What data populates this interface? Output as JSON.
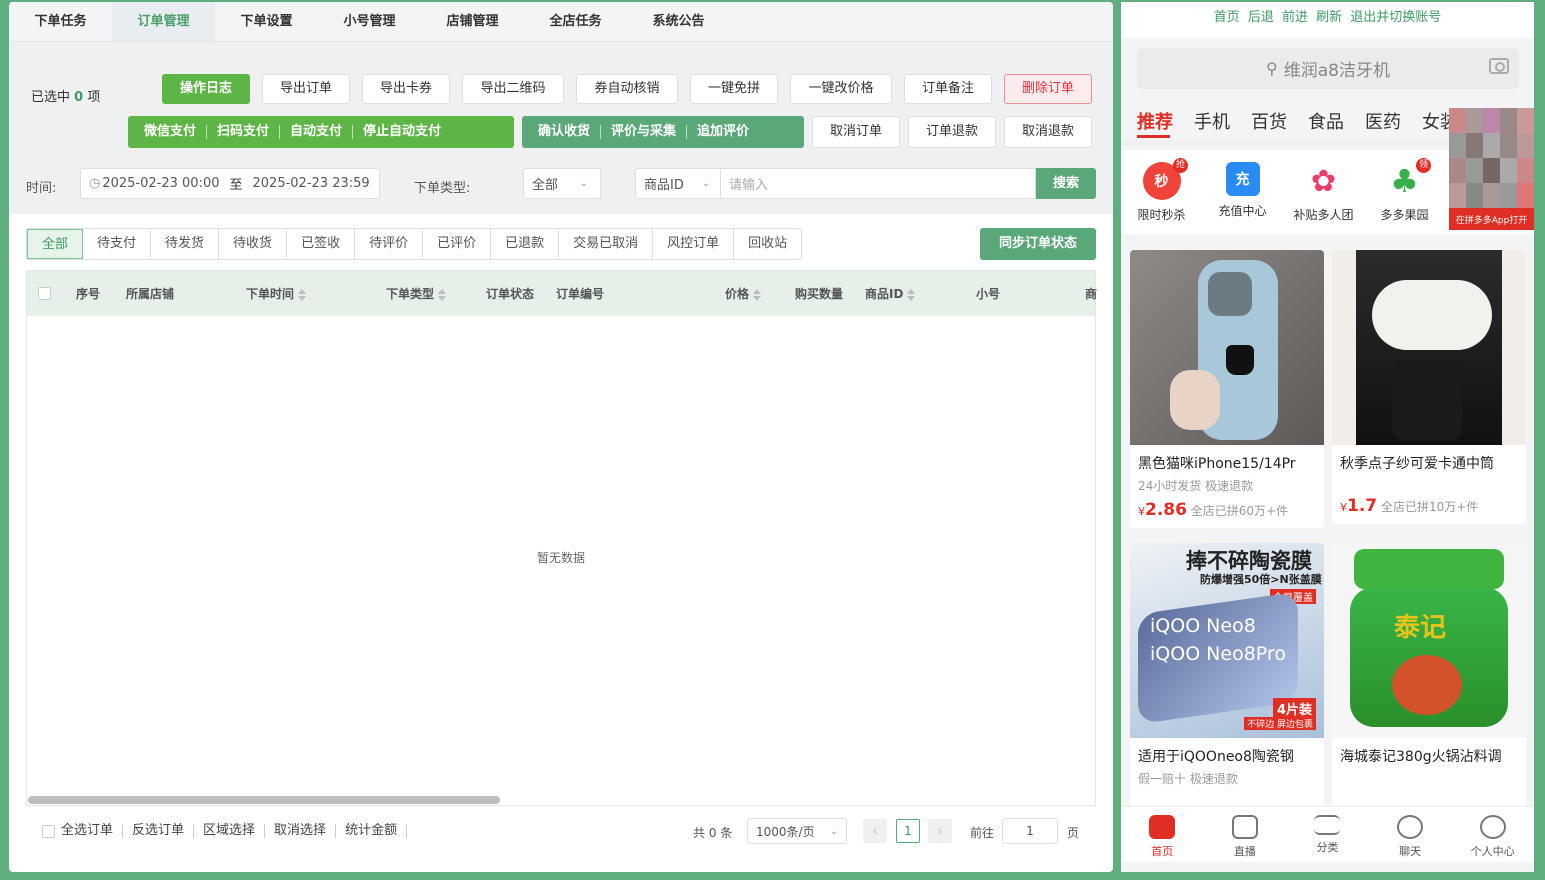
{
  "nav": {
    "tabs": [
      "下单任务",
      "订单管理",
      "下单设置",
      "小号管理",
      "店铺管理",
      "全店任务",
      "系统公告"
    ],
    "active_index": 1
  },
  "toolbar": {
    "selected_prefix": "已选中",
    "selected_count": "0",
    "selected_suffix": "项",
    "row1": [
      "操作日志",
      "导出订单",
      "导出卡券",
      "导出二维码",
      "券自动核销",
      "一键免拼",
      "一键改价格",
      "订单备注",
      "删除订单"
    ],
    "pay_group": [
      "微信支付",
      "扫码支付",
      "自动支付",
      "停止自动支付"
    ],
    "confirm_group": [
      "确认收货",
      "评价与采集",
      "追加评价"
    ],
    "row2_extra": [
      "取消订单",
      "订单退款",
      "取消退款"
    ]
  },
  "filters": {
    "time_label": "时间:",
    "time_start": "2025-02-23 00:00",
    "time_sep": "至",
    "time_end": "2025-02-23 23:59",
    "type_label": "下单类型:",
    "type_value": "全部",
    "field_select": "商品ID",
    "input_placeholder": "请输入",
    "search_label": "搜索"
  },
  "status_tabs": [
    "全部",
    "待支付",
    "待发货",
    "待收货",
    "已签收",
    "待评价",
    "已评价",
    "已退款",
    "交易已取消",
    "风控订单",
    "回收站"
  ],
  "sync_label": "同步订单状态",
  "table": {
    "columns": [
      "序号",
      "所属店铺",
      "下单时间",
      "下单类型",
      "订单状态",
      "订单编号",
      "价格",
      "购买数量",
      "商品ID",
      "小号",
      "商"
    ],
    "empty_text": "暂无数据"
  },
  "footer": {
    "actions": [
      "全选订单",
      "反选订单",
      "区域选择",
      "取消选择",
      "统计金额"
    ],
    "total": "共 0 条",
    "page_size": "1000条/页",
    "page": "1",
    "goto_label": "前往",
    "goto_value": "1",
    "page_unit": "页"
  },
  "mobile": {
    "links": [
      "首页",
      "后退",
      "前进",
      "刷新",
      "退出并切换账号"
    ],
    "search_text": "维润a8洁牙机",
    "categories": [
      "推荐",
      "手机",
      "百货",
      "食品",
      "医药",
      "女装"
    ],
    "icons": [
      {
        "label": "限时秒杀",
        "glyph": "秒",
        "badge": "抢",
        "color": "#f0433a"
      },
      {
        "label": "充值中心",
        "glyph": "充",
        "badge": "",
        "color": "#2a8bf2"
      },
      {
        "label": "补贴多人团",
        "glyph": "✿",
        "badge": "",
        "color": "#ee3d6a"
      },
      {
        "label": "多多果园",
        "glyph": "♣",
        "badge": "领",
        "color": "#36b04a"
      }
    ],
    "app_prompt": "在拼多多App打开",
    "products": [
      {
        "name": "黑色猫咪iPhone15/14Pr",
        "sub": "24小时发货  极速退款",
        "price": "2.86",
        "sold": "全店已拼60万+件"
      },
      {
        "name": "秋季点子纱可爱卡通中筒",
        "sub": "",
        "price": "1.7",
        "sold": "全店已拼10万+件"
      },
      {
        "name": "适用于iQOOneo8陶瓷钢",
        "sub": "假一赔十  极速退款",
        "price": "",
        "sold": ""
      },
      {
        "name": "海城泰记380g火锅沾料调",
        "sub": "",
        "price": "",
        "sold": ""
      }
    ],
    "product_overlay_texts": [
      "捧不碎陶瓷膜",
      "防爆增强50倍>N张盖膜",
      "全屏覆盖",
      "iQOO Neo8",
      "iQOO Neo8Pro",
      "4片装",
      "不碎边 屏边包裹",
      "泰记"
    ],
    "tabbar": [
      "首页",
      "直播",
      "分类",
      "聊天",
      "个人中心"
    ],
    "currency": "¥"
  }
}
